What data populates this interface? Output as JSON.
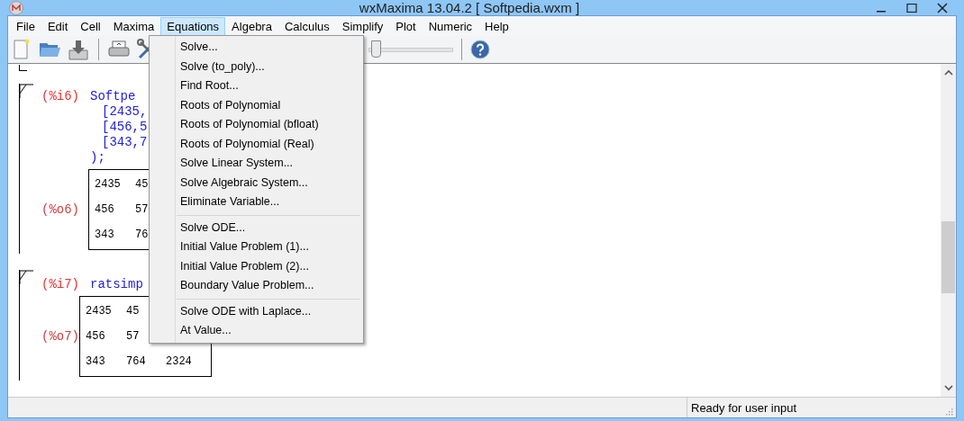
{
  "window": {
    "title": "wxMaxima 13.04.2  [ Softpedia.wxm ]"
  },
  "menubar": [
    {
      "label": "File",
      "selected": false
    },
    {
      "label": "Edit",
      "selected": false
    },
    {
      "label": "Cell",
      "selected": false
    },
    {
      "label": "Maxima",
      "selected": false
    },
    {
      "label": "Equations",
      "selected": true
    },
    {
      "label": "Algebra",
      "selected": false
    },
    {
      "label": "Calculus",
      "selected": false
    },
    {
      "label": "Simplify",
      "selected": false
    },
    {
      "label": "Plot",
      "selected": false
    },
    {
      "label": "Numeric",
      "selected": false
    },
    {
      "label": "Help",
      "selected": false
    }
  ],
  "toolbar": {
    "slider": {
      "level": 0.04
    }
  },
  "menu": [
    {
      "kind": "item",
      "label": "Solve..."
    },
    {
      "kind": "item",
      "label": "Solve (to_poly)..."
    },
    {
      "kind": "item",
      "label": "Find Root..."
    },
    {
      "kind": "item",
      "label": "Roots of Polynomial"
    },
    {
      "kind": "item",
      "label": "Roots of Polynomial (bfloat)"
    },
    {
      "kind": "item",
      "label": "Roots of Polynomial (Real)"
    },
    {
      "kind": "item",
      "label": "Solve Linear System..."
    },
    {
      "kind": "item",
      "label": "Solve Algebraic System..."
    },
    {
      "kind": "item",
      "label": "Eliminate Variable..."
    },
    {
      "kind": "separator"
    },
    {
      "kind": "item",
      "label": "Solve ODE..."
    },
    {
      "kind": "item",
      "label": "Initial Value Problem (1)..."
    },
    {
      "kind": "item",
      "label": "Initial Value Problem (2)..."
    },
    {
      "kind": "item",
      "label": "Boundary Value Problem..."
    },
    {
      "kind": "separator"
    },
    {
      "kind": "item",
      "label": "Solve ODE with Laplace..."
    },
    {
      "kind": "item",
      "label": "At Value..."
    }
  ],
  "document": [
    {
      "input": {
        "label": "(%i6)",
        "command": "Softpe",
        "args": [
          "[2435,",
          "[456,5",
          "[343,7"
        ],
        "close": ");"
      },
      "output": {
        "label": "(%o6)",
        "matrix": [
          [
            "2435",
            "45"
          ],
          [
            "456",
            "57"
          ],
          [
            "343",
            "76"
          ]
        ]
      }
    },
    {
      "input": {
        "label": "(%i7)",
        "command": "ratsimp"
      },
      "output": {
        "label": "(%o7)",
        "matrix": [
          [
            "2435",
            "45"
          ],
          [
            "456",
            "57"
          ],
          [
            "343",
            "764",
            "2324"
          ]
        ]
      }
    }
  ],
  "status_bar": "Ready for user input"
}
